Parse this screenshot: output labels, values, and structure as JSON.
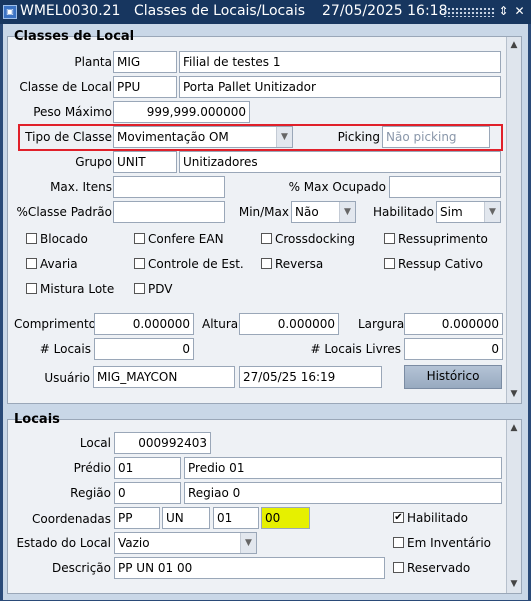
{
  "window": {
    "title_left": "WMEL0030.21",
    "title_center": "Classes de Locais/Locais",
    "title_datetime": "27/05/2025 16:18",
    "icon": "oracle-forms-icon",
    "controls": {
      "restore": "⇕",
      "close": "✕"
    }
  },
  "classes": {
    "section_title": "Classes de Local",
    "planta_label": "Planta",
    "planta_code": "MIG",
    "planta_desc": "Filial de testes 1",
    "classe_label": "Classe de Local",
    "classe_code": "PPU",
    "classe_desc": "Porta Pallet Unitizador",
    "peso_label": "Peso Máximo",
    "peso_value": "999,999.000000",
    "tipo_label": "Tipo de Classe",
    "tipo_value": "Movimentação OM",
    "picking_label": "Picking",
    "picking_value": "Não picking",
    "grupo_label": "Grupo",
    "grupo_code": "UNIT",
    "grupo_desc": "Unitizadores",
    "max_itens_label": "Max. Itens",
    "max_itens_value": "",
    "max_ocupado_label": "% Max Ocupado",
    "max_ocupado_value": "",
    "classe_padrao_label": "%Classe Padrão",
    "classe_padrao_value": "",
    "minmax_label": "Min/Max",
    "minmax_value": "Não",
    "habilitado_label": "Habilitado",
    "habilitado_value": "Sim",
    "checkboxes": {
      "bloqueado": "Blocado",
      "confere_ean": "Confere EAN",
      "crossdocking": "Crossdocking",
      "ressuprimento": "Ressuprimento",
      "avaria": "Avaria",
      "controle_est": "Controle de Est.",
      "reversa": "Reversa",
      "ressup_cativo": "Ressup Cativo",
      "mistura_lote": "Mistura Lote",
      "pdv": "PDV"
    },
    "comprimento_label": "Comprimento",
    "comprimento_value": "0.000000",
    "altura_label": "Altura",
    "altura_value": "0.000000",
    "largura_label": "Largura",
    "largura_value": "0.000000",
    "n_locais_label": "# Locais",
    "n_locais_value": "0",
    "n_locais_livres_label": "# Locais Livres",
    "n_locais_livres_value": "0",
    "usuario_label": "Usuário",
    "usuario_value": "MIG_MAYCON",
    "usuario_date": "27/05/25 16:19",
    "historico_button": "Histórico"
  },
  "locais": {
    "section_title": "Locais",
    "local_label": "Local",
    "local_value": "000992403",
    "predio_label": "Prédio",
    "predio_code": "01",
    "predio_desc": "Predio 01",
    "regiao_label": "Região",
    "regiao_code": "0",
    "regiao_desc": "Regiao 0",
    "coordenadas_label": "Coordenadas",
    "coord1": "PP",
    "coord2": "UN",
    "coord3": "01",
    "coord4": "00",
    "habilitado_label": "Habilitado",
    "habilitado_checked": true,
    "estado_label": "Estado do Local",
    "estado_value": "Vazio",
    "em_inventario_label": "Em Inventário",
    "descricao_label": "Descrição",
    "descricao_value": "PP UN 01 00",
    "reservado_label": "Reservado"
  },
  "colors": {
    "highlight_border": "#e0202a",
    "focus_field": "#e6f000",
    "titlebar": "#17365f"
  }
}
